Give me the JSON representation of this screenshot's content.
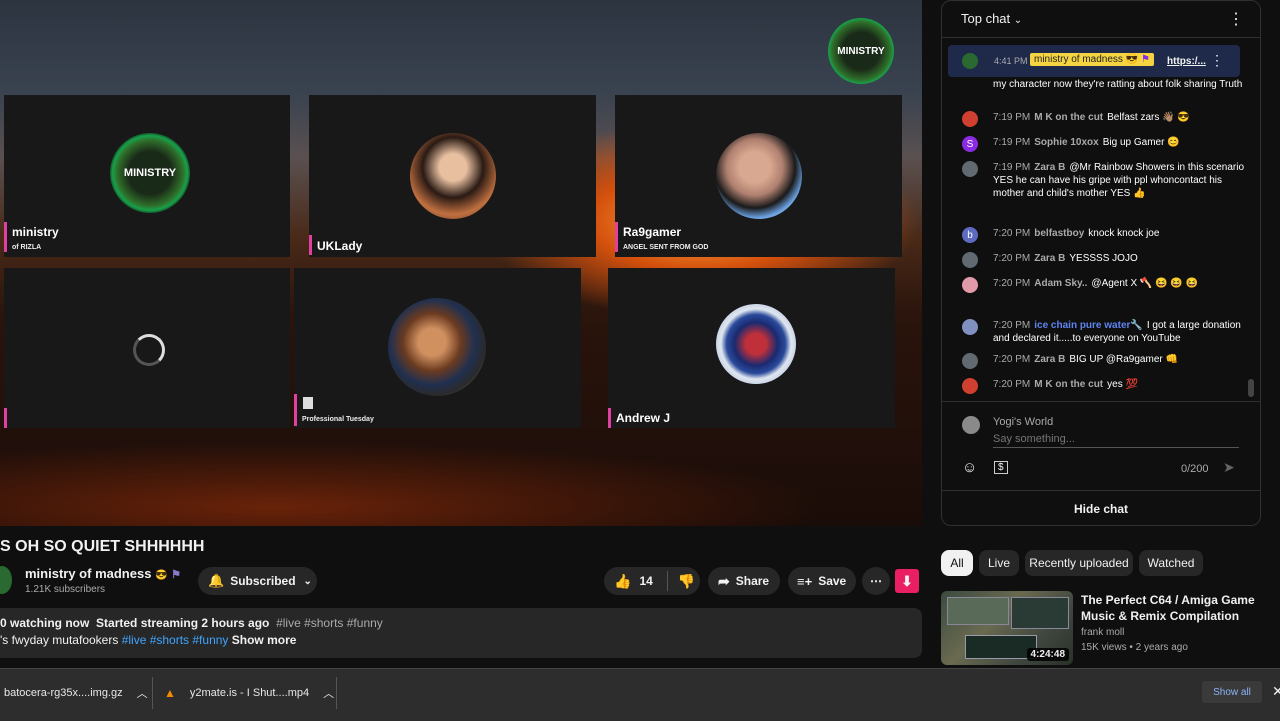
{
  "video": {
    "overlay_logo_text": "MINISTRY",
    "tiles": [
      {
        "name": "ministry",
        "sub": "of RIZLA",
        "avatar_text": "MINISTRY"
      },
      {
        "name": "UKLady",
        "sub": ""
      },
      {
        "name": "Ra9gamer",
        "sub": "ANGEL SENT FROM GOD"
      },
      {
        "name": "",
        "sub": ""
      },
      {
        "name": "",
        "sub": "Professional Tuesday"
      },
      {
        "name": "Andrew J",
        "sub": ""
      }
    ]
  },
  "title": "S OH SO QUIET SHHHHHH",
  "channel": {
    "name": "ministry of madness",
    "subs": "1.21K subscribers",
    "subscribed_label": "Subscribed"
  },
  "actions": {
    "likes": "14",
    "share": "Share",
    "save": "Save"
  },
  "description": {
    "watching": "0 watching now",
    "started": "Started streaming 2 hours ago",
    "tags1": "#live #shorts #funny",
    "line2": "'s fwyday mutafookers",
    "tags2": "#live #shorts #funny",
    "show_more": "Show more"
  },
  "chat": {
    "header": "Top chat",
    "pinned": {
      "time": "4:41 PM",
      "author": "ministry of madness",
      "link": "https:/..."
    },
    "pinned_cont": "my character now they're ratting about folk sharing Truth",
    "messages": [
      {
        "time": "7:19 PM",
        "author": "M K on the cut",
        "text": "Belfast zars 👋🏽 😎",
        "color": "#d04030"
      },
      {
        "time": "7:19 PM",
        "author": "Sophie 10xox",
        "text": "Big up Gamer 😊",
        "color": "#8a2be2",
        "initial": "S"
      },
      {
        "time": "7:19 PM",
        "author": "Zara B",
        "text": "@Mr Rainbow Showers in this scenario YES he can have his gripe with ppl whoncontact his mother and child's mother YES 👍",
        "color": "#606a70"
      },
      {
        "time": "7:20 PM",
        "author": "belfastboy",
        "text": "knock knock joe",
        "color": "#5c6bc0",
        "initial": "b"
      },
      {
        "time": "7:20 PM",
        "author": "Zara B",
        "text": "YESSSS JOJO",
        "color": "#606a70"
      },
      {
        "time": "7:20 PM",
        "author": "Adam Sky..",
        "text": "@Agent X 🪓 😆 😆 😆",
        "color": "#e09aa8"
      },
      {
        "time": "7:20 PM",
        "author": "ice chain pure water🔧",
        "text": "I got a large donation and declared it.....to everyone on YouTube",
        "color": "#8090c0",
        "author_color": "#5e84f1"
      },
      {
        "time": "7:20 PM",
        "author": "Zara B",
        "text": "BIG UP @Ra9gamer 👊",
        "color": "#606a70"
      },
      {
        "time": "7:20 PM",
        "author": "M K on the cut",
        "text": "yes 💯",
        "color": "#d04030"
      }
    ],
    "input_user": "Yogi's World",
    "input_placeholder": "Say something...",
    "counter": "0/200",
    "hide": "Hide chat"
  },
  "chips": [
    "All",
    "Live",
    "Recently uploaded",
    "Watched"
  ],
  "recommended": {
    "title": "The Perfect C64 / Amiga Game Music & Remix Compilation",
    "channel": "frank moll",
    "meta": "15K views • 2 years ago",
    "duration": "4:24:48"
  },
  "downloads": {
    "items": [
      "batocera-rg35x....img.gz",
      "y2mate.is - I Shut....mp4"
    ],
    "show_all": "Show all"
  },
  "colors": {
    "accent": "#e040a0",
    "link": "#3ea6ff",
    "download_btn": "#e91e63"
  }
}
